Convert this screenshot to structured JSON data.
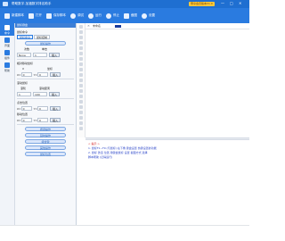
{
  "window": {
    "title": "帮助数字-加福数字排名助手",
    "vip_badge": "尊享会员版本V1.0",
    "controls": {
      "minimize": "—",
      "maximize": "□",
      "close": "✕"
    }
  },
  "toolbar": {
    "items": [
      {
        "label": "新建脚本",
        "icon": "plus-icon"
      },
      {
        "label": "打开",
        "icon": "folder-icon"
      },
      {
        "label": "保存脚本",
        "icon": "save-icon"
      },
      {
        "label": "调试",
        "icon": "debug-icon"
      },
      {
        "label": "运行",
        "icon": "play-icon"
      },
      {
        "label": "停止",
        "icon": "stop-icon"
      },
      {
        "label": "截图",
        "icon": "camera-icon"
      },
      {
        "label": "设置",
        "icon": "gear-icon"
      }
    ]
  },
  "sidenav": {
    "items": [
      {
        "label": "命令",
        "icon": "command-icon",
        "active": true
      },
      {
        "label": "界面",
        "icon": "window-icon",
        "active": false
      },
      {
        "label": "插件",
        "icon": "plugin-icon",
        "active": false
      },
      {
        "label": "帮助",
        "icon": "help-icon",
        "active": false
      }
    ]
  },
  "panel": {
    "header": "鼠标键盘",
    "section1": {
      "title": "鼠标命令",
      "tabs": [
        "鼠标命令",
        "鼠标控制"
      ],
      "pill": "鼠标操作",
      "row1": {
        "label_a": "次数",
        "label_b": "单击",
        "select_value": "None",
        "select2_value": "1",
        "button": "插入"
      }
    },
    "section2": {
      "title": "相对移动坐标",
      "row_labels": {
        "a": "X",
        "b": "坐标"
      },
      "x_label": "X=",
      "x_value": "0",
      "y_label": "Y=",
      "y_value": "0",
      "button": "插入"
    },
    "section3": {
      "title": "滚动鼠标",
      "labels": {
        "a": "滚轮",
        "b": "滚动距离"
      },
      "value_a": "1",
      "value_b": "100",
      "button": "插入"
    },
    "section4": {
      "title": "点击位置",
      "x_label": "X=",
      "x_value": "0",
      "y_label": "Y=",
      "y_value": "0",
      "button": "插入"
    },
    "section5": {
      "title": "移动位置",
      "x_label": "X=",
      "x_value": "0",
      "y_label": "Y=",
      "y_value": "0",
      "button": "插入"
    },
    "bottom_pills": [
      "按键操作",
      "延时操作",
      "组合键",
      "其他操作",
      "鼠标位置"
    ]
  },
  "editor": {
    "close_icon": "✕",
    "tab_label": "未命名"
  },
  "output": {
    "header": "< 提示 >",
    "lines": [
      "1. 鼠标F1~F9 (与鼠标) 右下角 键盘设置 热键设置的功能",
      "2. 鼠标 激活 位置 用键盘鼠标 设置 截图方式 选择",
      "脚本帮助 (记得运行)"
    ]
  },
  "colors": {
    "titlebar": "#1f6fd1",
    "toolbar": "#2a7be0",
    "output_header": "#d11c1c",
    "output_text": "#2b45c8"
  }
}
